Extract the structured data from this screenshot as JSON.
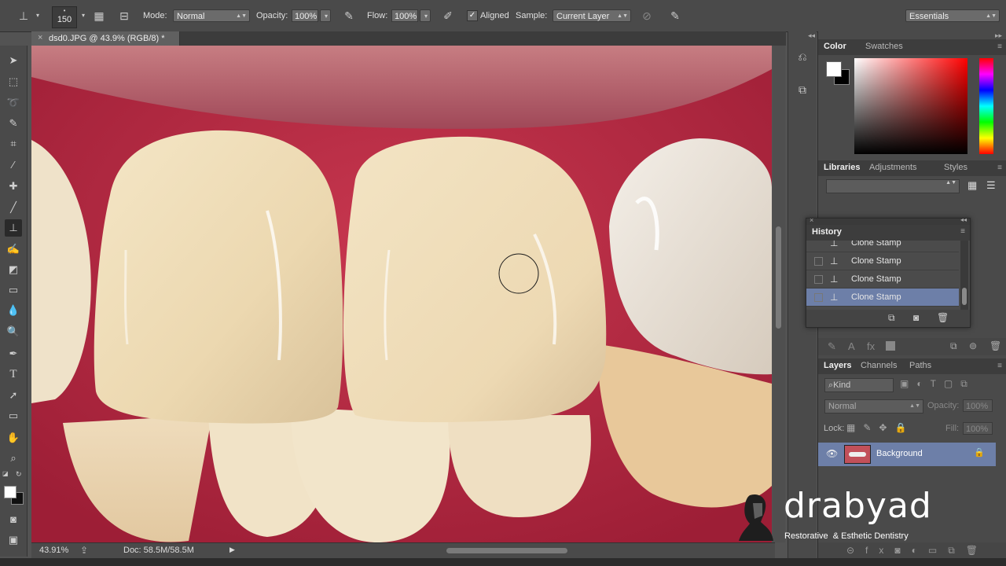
{
  "options_bar": {
    "brush_size": "150",
    "mode_label": "Mode:",
    "mode_value": "Normal",
    "opacity_label": "Opacity:",
    "opacity_value": "100%",
    "flow_label": "Flow:",
    "flow_value": "100%",
    "aligned_label": "Aligned",
    "sample_label": "Sample:",
    "sample_value": "Current Layer",
    "workspace_value": "Essentials"
  },
  "document": {
    "tab_title": "dsd0.JPG @ 43.9% (RGB/8) *",
    "zoom": "43.91%",
    "doc_size": "Doc: 58.5M/58.5M"
  },
  "color_panel": {
    "tabs": [
      "Color",
      "Swatches"
    ]
  },
  "libraries_panel": {
    "tabs": [
      "Libraries",
      "Adjustments",
      "Styles"
    ]
  },
  "history_panel": {
    "title": "History",
    "items": [
      {
        "label": "Clone Stamp"
      },
      {
        "label": "Clone Stamp"
      },
      {
        "label": "Clone Stamp"
      },
      {
        "label": "Clone Stamp",
        "selected": true
      }
    ]
  },
  "layers_panel": {
    "tabs": [
      "Layers",
      "Channels",
      "Paths"
    ],
    "filter_kind": "Kind",
    "blend_mode": "Normal",
    "opacity_label": "Opacity:",
    "opacity_value": "100%",
    "lock_label": "Lock:",
    "fill_label": "Fill:",
    "fill_value": "100%",
    "layers": [
      {
        "name": "Background",
        "visible": true,
        "locked": true
      }
    ]
  },
  "watermark": {
    "brand": "drabyad",
    "tagline": "Restorative  & Esthetic Dentistry"
  },
  "colors": {
    "selected_history": "#6d7fa8",
    "selected_layer": "#6d7fa8",
    "gum": "#b8324a",
    "tooth": "#eedfc0"
  },
  "icons": {
    "toolbar": [
      "move-icon",
      "marquee-icon",
      "lasso-icon",
      "quick-select-icon",
      "crop-icon",
      "eyedropper-icon",
      "healing-brush-icon",
      "brush-icon",
      "clone-stamp-icon",
      "history-brush-icon",
      "eraser-icon",
      "gradient-icon",
      "blur-icon",
      "dodge-icon",
      "pen-icon",
      "type-icon",
      "path-select-icon",
      "rectangle-icon",
      "hand-icon",
      "zoom-icon"
    ]
  }
}
